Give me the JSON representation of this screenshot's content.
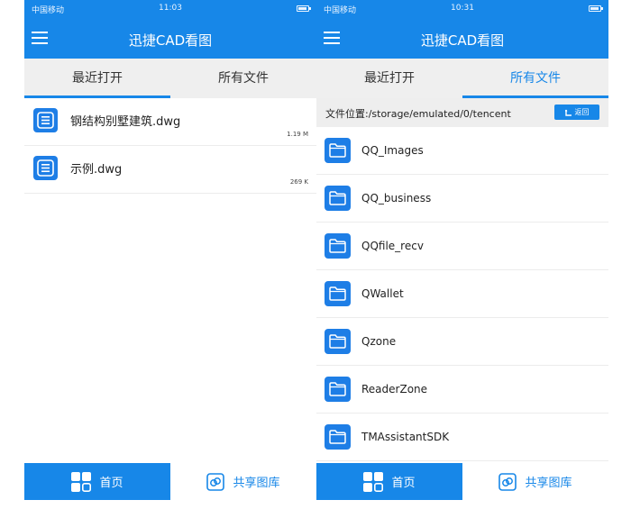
{
  "left": {
    "status": {
      "carrier": "中国移动",
      "time": "11:03",
      "battery_level": 0.85
    },
    "header": {
      "title": "迅捷CAD看图"
    },
    "tabs": [
      {
        "label": "最近打开",
        "active": true
      },
      {
        "label": "所有文件",
        "active": false
      }
    ],
    "recent_files": [
      {
        "name": "钢结构别墅建筑.dwg",
        "size": "1.19 M"
      },
      {
        "name": "示例.dwg",
        "size": "269 K"
      }
    ],
    "bottom_nav": {
      "home": "首页",
      "share": "共享图库"
    }
  },
  "right": {
    "status": {
      "carrier": "中国移动",
      "time": "10:31",
      "battery_level": 0.85
    },
    "header": {
      "title": "迅捷CAD看图"
    },
    "tabs": [
      {
        "label": "最近打开",
        "active": false
      },
      {
        "label": "所有文件",
        "active": true
      }
    ],
    "path": {
      "label": "文件位置:/storage/emulated/0/tencent",
      "back": "返回"
    },
    "folders": [
      {
        "name": "QQ_Images"
      },
      {
        "name": "QQ_business"
      },
      {
        "name": "QQfile_recv"
      },
      {
        "name": "QWallet"
      },
      {
        "name": "Qzone"
      },
      {
        "name": "ReaderZone"
      },
      {
        "name": "TMAssistantSDK"
      }
    ],
    "bottom_nav": {
      "home": "首页",
      "share": "共享图库"
    }
  },
  "colors": {
    "accent": "#1787e8",
    "file_icon": "#1e7ee6",
    "tab_bar": "#efefef"
  },
  "icons": {
    "menu": "hamburger-icon",
    "file": "document-icon",
    "folder": "folder-icon",
    "home": "grid-icon",
    "share": "share-gallery-icon",
    "back": "return-arrow-icon"
  }
}
